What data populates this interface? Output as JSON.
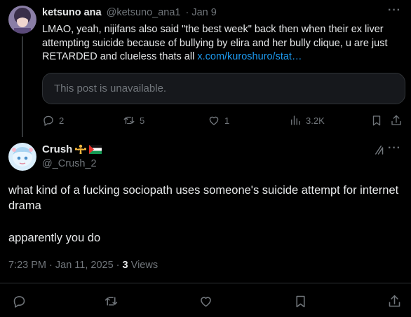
{
  "parent": {
    "display_name": "ketsuno ana",
    "handle": "@ketsuno_ana1",
    "date": "· Jan 9",
    "body_text": "LMAO, yeah, nijifans also said \"the best week\" back then when their ex liver attempting suicide because of bullying by elira and her bully clique, u are just RETARDED and clueless thats all ",
    "link_text": "x.com/kuroshuro/stat…",
    "quote_unavailable": "This post is unavailable.",
    "replies": "2",
    "reposts": "5",
    "likes": "1",
    "views": "3.2K"
  },
  "main": {
    "display_name": "Crush",
    "handle": "@_Crush_2",
    "body_line1": "what kind of a fucking sociopath uses someone's suicide attempt for internet drama",
    "body_line2": "apparently you do",
    "timestamp": "7:23 PM · Jan 11, 2025 · ",
    "views_count": "3",
    "views_label": " Views"
  },
  "icons": {
    "reply": "reply-icon",
    "repost": "repost-icon",
    "like": "heart-icon",
    "views": "views-icon",
    "bookmark": "bookmark-icon",
    "share": "share-icon",
    "grok": "grok-icon",
    "more": "more-icon",
    "emoji_1": "weight-lifter-emoji",
    "emoji_2": "palestine-flag-emoji"
  },
  "colors": {
    "background": "#000000",
    "text": "#e7e9ea",
    "muted": "#71767b",
    "link": "#1d9bf0",
    "border": "#2f3336"
  }
}
